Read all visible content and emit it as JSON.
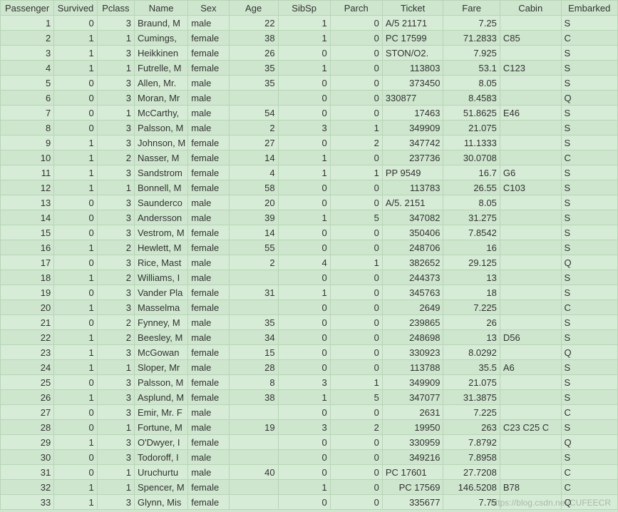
{
  "columns": [
    "Passenger",
    "Survived",
    "Pclass",
    "Name",
    "Sex",
    "Age",
    "SibSp",
    "Parch",
    "Ticket",
    "Fare",
    "Cabin",
    "Embarked"
  ],
  "column_align": [
    "num",
    "num",
    "num",
    "txt",
    "txt",
    "num",
    "num",
    "num",
    "txt",
    "num",
    "txt",
    "txt"
  ],
  "rows": [
    [
      "1",
      "0",
      "3",
      "Braund, M",
      "male",
      "22",
      "1",
      "0",
      "A/5 21171",
      "7.25",
      "",
      "S"
    ],
    [
      "2",
      "1",
      "1",
      "Cumings, ",
      "female",
      "38",
      "1",
      "0",
      "PC 17599",
      "71.2833",
      "C85",
      "C"
    ],
    [
      "3",
      "1",
      "3",
      "Heikkinen",
      "female",
      "26",
      "0",
      "0",
      "STON/O2.",
      "7.925",
      "",
      "S"
    ],
    [
      "4",
      "1",
      "1",
      "Futrelle, M",
      "female",
      "35",
      "1",
      "0",
      "113803",
      "53.1",
      "C123",
      "S"
    ],
    [
      "5",
      "0",
      "3",
      "Allen, Mr.",
      "male",
      "35",
      "0",
      "0",
      "373450",
      "8.05",
      "",
      "S"
    ],
    [
      "6",
      "0",
      "3",
      "Moran, Mr",
      "male",
      "",
      "0",
      "0",
      "330877",
      "8.4583",
      "",
      "Q"
    ],
    [
      "7",
      "0",
      "1",
      "McCarthy,",
      "male",
      "54",
      "0",
      "0",
      "17463",
      "51.8625",
      "E46",
      "S"
    ],
    [
      "8",
      "0",
      "3",
      "Palsson, M",
      "male",
      "2",
      "3",
      "1",
      "349909",
      "21.075",
      "",
      "S"
    ],
    [
      "9",
      "1",
      "3",
      "Johnson, M",
      "female",
      "27",
      "0",
      "2",
      "347742",
      "11.1333",
      "",
      "S"
    ],
    [
      "10",
      "1",
      "2",
      "Nasser, M",
      "female",
      "14",
      "1",
      "0",
      "237736",
      "30.0708",
      "",
      "C"
    ],
    [
      "11",
      "1",
      "3",
      "Sandstrom",
      "female",
      "4",
      "1",
      "1",
      "PP 9549",
      "16.7",
      "G6",
      "S"
    ],
    [
      "12",
      "1",
      "1",
      "Bonnell, M",
      "female",
      "58",
      "0",
      "0",
      "113783",
      "26.55",
      "C103",
      "S"
    ],
    [
      "13",
      "0",
      "3",
      "Saunderco",
      "male",
      "20",
      "0",
      "0",
      "A/5. 2151",
      "8.05",
      "",
      "S"
    ],
    [
      "14",
      "0",
      "3",
      "Andersson",
      "male",
      "39",
      "1",
      "5",
      "347082",
      "31.275",
      "",
      "S"
    ],
    [
      "15",
      "0",
      "3",
      "Vestrom, M",
      "female",
      "14",
      "0",
      "0",
      "350406",
      "7.8542",
      "",
      "S"
    ],
    [
      "16",
      "1",
      "2",
      "Hewlett, M",
      "female",
      "55",
      "0",
      "0",
      "248706",
      "16",
      "",
      "S"
    ],
    [
      "17",
      "0",
      "3",
      "Rice, Mast",
      "male",
      "2",
      "4",
      "1",
      "382652",
      "29.125",
      "",
      "Q"
    ],
    [
      "18",
      "1",
      "2",
      "Williams, I",
      "male",
      "",
      "0",
      "0",
      "244373",
      "13",
      "",
      "S"
    ],
    [
      "19",
      "0",
      "3",
      "Vander Pla",
      "female",
      "31",
      "1",
      "0",
      "345763",
      "18",
      "",
      "S"
    ],
    [
      "20",
      "1",
      "3",
      "Masselma",
      "female",
      "",
      "0",
      "0",
      "2649",
      "7.225",
      "",
      "C"
    ],
    [
      "21",
      "0",
      "2",
      "Fynney, M",
      "male",
      "35",
      "0",
      "0",
      "239865",
      "26",
      "",
      "S"
    ],
    [
      "22",
      "1",
      "2",
      "Beesley, M",
      "male",
      "34",
      "0",
      "0",
      "248698",
      "13",
      "D56",
      "S"
    ],
    [
      "23",
      "1",
      "3",
      "McGowan",
      "female",
      "15",
      "0",
      "0",
      "330923",
      "8.0292",
      "",
      "Q"
    ],
    [
      "24",
      "1",
      "1",
      "Sloper, Mr",
      "male",
      "28",
      "0",
      "0",
      "113788",
      "35.5",
      "A6",
      "S"
    ],
    [
      "25",
      "0",
      "3",
      "Palsson, M",
      "female",
      "8",
      "3",
      "1",
      "349909",
      "21.075",
      "",
      "S"
    ],
    [
      "26",
      "1",
      "3",
      "Asplund, M",
      "female",
      "38",
      "1",
      "5",
      "347077",
      "31.3875",
      "",
      "S"
    ],
    [
      "27",
      "0",
      "3",
      "Emir, Mr. F",
      "male",
      "",
      "0",
      "0",
      "2631",
      "7.225",
      "",
      "C"
    ],
    [
      "28",
      "0",
      "1",
      "Fortune, M",
      "male",
      "19",
      "3",
      "2",
      "19950",
      "263",
      "C23 C25 C",
      "S"
    ],
    [
      "29",
      "1",
      "3",
      "O'Dwyer, I",
      "female",
      "",
      "0",
      "0",
      "330959",
      "7.8792",
      "",
      "Q"
    ],
    [
      "30",
      "0",
      "3",
      "Todoroff, I",
      "male",
      "",
      "0",
      "0",
      "349216",
      "7.8958",
      "",
      "S"
    ],
    [
      "31",
      "0",
      "1",
      "Uruchurtu",
      "male",
      "40",
      "0",
      "0",
      "PC 17601",
      "27.7208",
      "",
      "C"
    ],
    [
      "32",
      "1",
      "1",
      "Spencer, M",
      "female",
      "",
      "1",
      "0",
      "PC 17569",
      "146.5208",
      "B78",
      "C"
    ],
    [
      "33",
      "1",
      "3",
      "Glynn, Mis",
      "female",
      "",
      "0",
      "0",
      "335677",
      "7.75",
      "",
      "Q"
    ]
  ],
  "ticket_align_right": {
    "3": true,
    "4": true,
    "6": true,
    "7": true,
    "8": true,
    "9": true,
    "11": true,
    "13": true,
    "14": true,
    "15": true,
    "16": true,
    "17": true,
    "18": true,
    "19": true,
    "20": true,
    "21": true,
    "22": true,
    "23": true,
    "24": true,
    "25": true,
    "26": true,
    "27": true,
    "28": true,
    "29": true,
    "31": true,
    "32": true
  },
  "watermark": "https://blog.csdn.net/CUFEECR"
}
